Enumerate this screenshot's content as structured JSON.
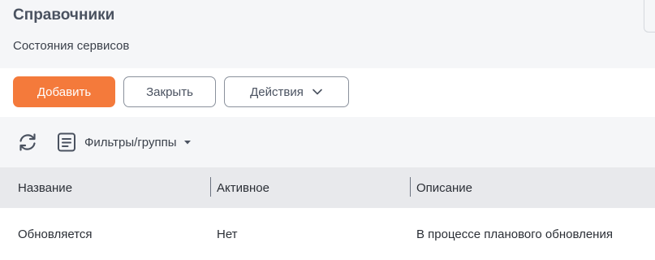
{
  "header": {
    "title": "Справочники",
    "subtitle": "Состояния сервисов"
  },
  "toolbar": {
    "add_label": "Добавить",
    "close_label": "Закрыть",
    "actions_label": "Действия"
  },
  "filters": {
    "label": "Фильтры/группы"
  },
  "table": {
    "columns": [
      "Название",
      "Активное",
      "Описание"
    ],
    "rows": [
      [
        "Обновляется",
        "Нет",
        "В процессе планового обновления"
      ]
    ]
  },
  "colors": {
    "accent": "#f47a3b",
    "background": "#f5f6f8",
    "header_row": "#e8e9ec"
  },
  "icons": [
    "refresh-icon",
    "list-icon",
    "caret-down-icon",
    "chevron-down-icon"
  ]
}
